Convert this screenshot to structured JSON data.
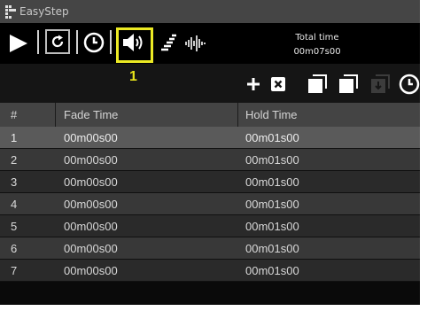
{
  "window": {
    "title": "EasyStep"
  },
  "transport": {
    "total_time_label": "Total time",
    "total_time_value": "00m07s00",
    "buttons": [
      {
        "name": "play",
        "icon": "play-icon"
      },
      {
        "name": "loop",
        "icon": "loop-icon"
      },
      {
        "name": "clock",
        "icon": "clock-icon"
      },
      {
        "name": "sound",
        "icon": "speaker-icon",
        "highlighted": true
      },
      {
        "name": "fade",
        "icon": "fade-bars-icon"
      },
      {
        "name": "audio",
        "icon": "waveform-icon"
      }
    ]
  },
  "toolbar": {
    "callout": "1",
    "buttons": [
      {
        "name": "add",
        "icon": "plus-icon"
      },
      {
        "name": "delete",
        "icon": "delete-icon"
      },
      {
        "name": "copy",
        "icon": "copy-icon"
      },
      {
        "name": "paste",
        "icon": "paste-icon"
      },
      {
        "name": "insert",
        "icon": "insert-icon",
        "disabled": true
      },
      {
        "name": "time",
        "icon": "clock-icon"
      }
    ]
  },
  "table": {
    "columns": [
      "#",
      "Fade Time",
      "Hold Time"
    ],
    "rows": [
      {
        "num": "1",
        "fade": "00m00s00",
        "hold": "00m01s00",
        "selected": true
      },
      {
        "num": "2",
        "fade": "00m00s00",
        "hold": "00m01s00"
      },
      {
        "num": "3",
        "fade": "00m00s00",
        "hold": "00m01s00"
      },
      {
        "num": "4",
        "fade": "00m00s00",
        "hold": "00m01s00"
      },
      {
        "num": "5",
        "fade": "00m00s00",
        "hold": "00m01s00"
      },
      {
        "num": "6",
        "fade": "00m00s00",
        "hold": "00m01s00"
      },
      {
        "num": "7",
        "fade": "00m00s00",
        "hold": "00m01s00"
      }
    ]
  },
  "colors": {
    "highlight": "#ecea24",
    "selected_row": "#5a5a5a",
    "header": "#444444"
  }
}
